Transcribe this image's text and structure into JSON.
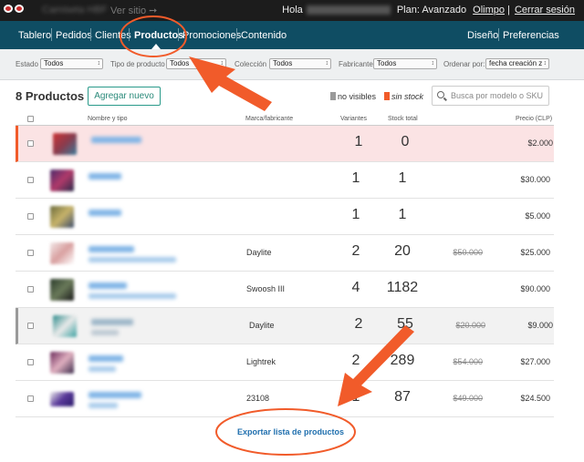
{
  "topbar": {
    "store_name": "Camiseta HBF",
    "view_site": "Ver sitio ➙",
    "greeting": "Hola",
    "user_name": "Juan Pablo Alvarado",
    "plan": "Plan: Avanzado",
    "plan_link": "Olimpo",
    "logout": "Cerrar sesión"
  },
  "nav": {
    "items": [
      "Tablero",
      "Pedidos",
      "Clientes",
      "Productos",
      "Promociones",
      "Contenido"
    ],
    "active": "Productos",
    "right_items": [
      "Diseño",
      "Preferencias"
    ]
  },
  "filters": {
    "estado_label": "Estado",
    "estado_value": "Todos",
    "tipo_label": "Tipo de producto",
    "tipo_value": "Todos",
    "coleccion_label": "Colección",
    "coleccion_value": "Todos",
    "fabricante_label": "Fabricante",
    "fabricante_value": "Todos",
    "orden_label": "Ordenar por:",
    "orden_value": "fecha creación z"
  },
  "header": {
    "count": "8 Productos",
    "add_button": "Agregar nuevo",
    "legend_not_visible": "no visibles",
    "legend_no_stock": "sin stock",
    "search_placeholder": "Busca por modelo o SKU"
  },
  "table": {
    "columns": [
      "Nombre y tipo",
      "Marca/fabricante",
      "Variantes",
      "Stock total",
      "Precio (CLP)"
    ],
    "rows": [
      {
        "name": "Scooter",
        "type": "",
        "brand": "",
        "variants": "1",
        "stock": "0",
        "old_price": "",
        "price": "$2.000",
        "status": "no-stock"
      },
      {
        "name": "Pavel I",
        "type": "",
        "brand": "",
        "variants": "1",
        "stock": "1",
        "old_price": "",
        "price": "$30.000",
        "status": ""
      },
      {
        "name": "Hikaros",
        "type": "",
        "brand": "",
        "variants": "1",
        "stock": "1",
        "old_price": "",
        "price": "$5.000",
        "status": ""
      },
      {
        "name": "Jackson Pop",
        "type": "Tienda de buen producto",
        "brand": "Daylite",
        "variants": "2",
        "stock": "20",
        "old_price": "$50.000",
        "price": "$25.000",
        "status": ""
      },
      {
        "name": "Pony Blue",
        "type": "Tienda de buen producto",
        "brand": "Swoosh III",
        "variants": "4",
        "stock": "1182",
        "old_price": "",
        "price": "$90.000",
        "status": ""
      },
      {
        "name": "El Cable 20",
        "type": "Artefacto",
        "brand": "Daylite",
        "variants": "2",
        "stock": "55",
        "old_price": "$20.000",
        "price": "$9.000",
        "status": "not-visible"
      },
      {
        "name": "Mallino 5",
        "type": "Calzado",
        "brand": "Lightrek",
        "variants": "2",
        "stock": "289",
        "old_price": "$54.000",
        "price": "$27.000",
        "status": ""
      },
      {
        "name": "Boombox 40",
        "type": "Artefacto",
        "brand": "23108",
        "variants": "1",
        "stock": "87",
        "old_price": "$49.000",
        "price": "$24.500",
        "status": ""
      }
    ]
  },
  "export_link": "Exportar lista de productos",
  "colors": {
    "nav_bg": "#0f4d63",
    "topbar_bg": "#1c1c1c",
    "accent_teal": "#2a9a8a",
    "annotation_orange": "#f15b2a",
    "link_blue": "#1f6fae"
  }
}
